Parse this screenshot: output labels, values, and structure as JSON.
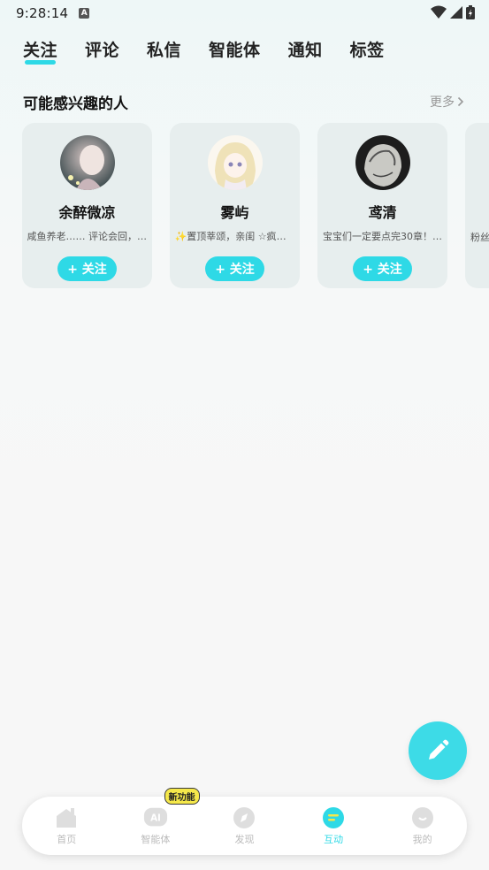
{
  "status": {
    "time": "9:28:14",
    "a_badge": "A"
  },
  "tabs": [
    {
      "label": "关注",
      "active": true
    },
    {
      "label": "评论"
    },
    {
      "label": "私信"
    },
    {
      "label": "智能体"
    },
    {
      "label": "通知"
    },
    {
      "label": "标签"
    }
  ],
  "suggest": {
    "title": "可能感兴趣的人",
    "more": "更多",
    "cards": [
      {
        "name": "余醉微凉",
        "desc": "咸鱼养老…… 评论会回，不…",
        "follow": "+ 关注"
      },
      {
        "name": "雾屿",
        "desc": "✨置顶莘颂，亲闺 ☆疯人…",
        "follow": "+ 关注"
      },
      {
        "name": "鸢清",
        "desc": "宝宝们一定要点完30章！…",
        "follow": "+ 关注"
      }
    ],
    "partial_desc": "粉丝"
  },
  "nav": {
    "items": [
      {
        "label": "首页",
        "icon": "home-icon"
      },
      {
        "label": "智能体",
        "icon": "ai-icon",
        "badge": "新功能"
      },
      {
        "label": "发现",
        "icon": "discover-icon"
      },
      {
        "label": "互动",
        "icon": "interact-icon",
        "active": true
      },
      {
        "label": "我的",
        "icon": "profile-icon"
      }
    ]
  },
  "colors": {
    "accent": "#2ed9e6",
    "fab": "#3ddbe7"
  }
}
